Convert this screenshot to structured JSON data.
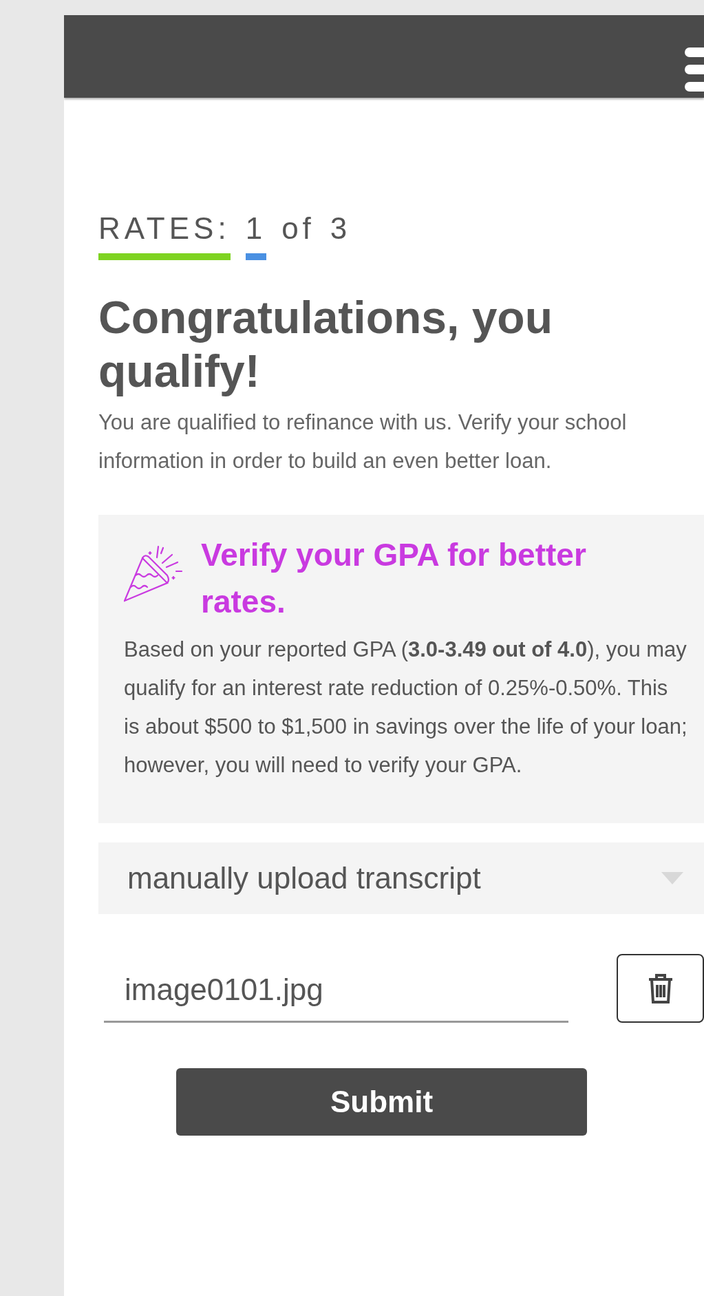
{
  "progress": {
    "label": "RATES:",
    "current": "1",
    "separator": "of",
    "total": "3"
  },
  "heading": "Congratulations, you qualify!",
  "intro": "You are qualified to refinance with us. Verify your school information in order to build an even better loan.",
  "promo": {
    "title": "Verify your GPA for better rates.",
    "body": "Based on your reported GPA (**3.0-3.49 out of 4.0**), you may qualify for an interest rate reduction of 0.25%-0.50%. This is about $500 to $1,500 in savings over the life of your loan; however, you will need to verify your GPA."
  },
  "method_select": {
    "value": "manually upload transcript"
  },
  "file_field": {
    "value": "image0101.jpg"
  },
  "submit_button": "Submit"
}
